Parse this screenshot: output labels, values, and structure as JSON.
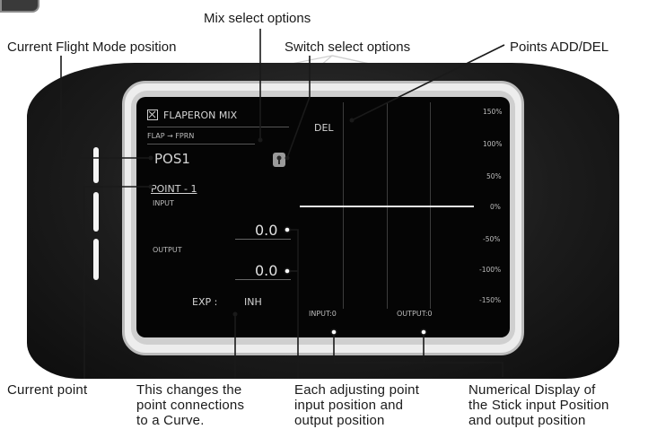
{
  "callouts": {
    "mix_select": "Mix select options",
    "current_flight_mode": "Current Flight Mode position",
    "switch_select": "Switch select options",
    "points_add_del": "Points ADD/DEL",
    "current_point": "Current point",
    "exp_note": [
      "This changes the",
      "point connections",
      "to a Curve."
    ],
    "adjusting_point": [
      "Each adjusting point",
      "input position and",
      "output position"
    ],
    "numerical_display": [
      "Numerical Display of",
      "the Stick input Position",
      "and output position"
    ]
  },
  "screen": {
    "title": "FLAPERON MIX",
    "mix_path": "FLAP → FPRN",
    "position": "POS1",
    "point": "POINT - 1",
    "input_label": "INPUT",
    "input_value": "0.0",
    "output_label": "OUTPUT",
    "output_value": "0.0",
    "exp_label": "EXP :",
    "exp_value": "INH",
    "add_del": "DEL",
    "input_readout": "INPUT:0",
    "output_readout": "OUTPUT:0",
    "y_ticks": [
      "150%",
      "100%",
      "50%",
      "0%",
      "-50%",
      "-100%",
      "-150%"
    ]
  },
  "colors": {
    "screen_bg": "#050505",
    "lcd_text": "#d4d4d4",
    "callout_line": "#1a1a1a",
    "bezel": "#1c1c1c"
  }
}
